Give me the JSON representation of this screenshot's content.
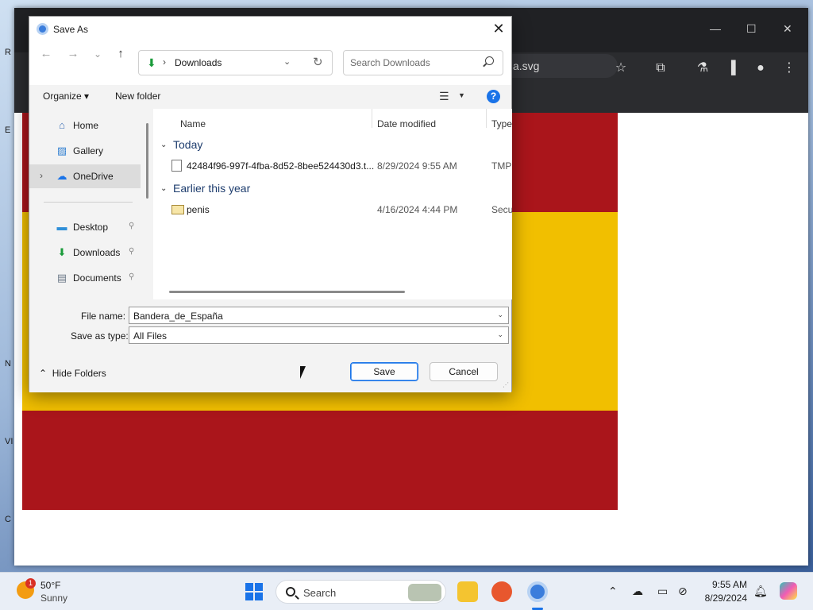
{
  "desktop": {
    "letters": [
      "R",
      "E",
      "N",
      "VI",
      "C"
    ]
  },
  "browser": {
    "omnibox_text": "a.svg",
    "window_controls": {
      "minimize": "—",
      "maximize": "☐",
      "close": "✕"
    }
  },
  "flag": {
    "colors": {
      "red": "#aa151b",
      "yellow": "#f1bf00"
    }
  },
  "dialog": {
    "title": "Save As",
    "close_glyph": "✕",
    "nav": {
      "back": "←",
      "forward": "→",
      "recent": "⌄",
      "up": "↑"
    },
    "address": {
      "separator": "›",
      "location": "Downloads"
    },
    "search": {
      "placeholder": "Search Downloads"
    },
    "commands": {
      "organize": "Organize ▾",
      "new_folder": "New folder",
      "help": "?"
    },
    "nav_pane": {
      "items": [
        {
          "label": "Home",
          "icon": "home-icon",
          "glyph": "⌂",
          "color": "#3b6fb6"
        },
        {
          "label": "Gallery",
          "icon": "gallery-icon",
          "glyph": "▨",
          "color": "#2f7fd1"
        },
        {
          "label": "OneDrive",
          "icon": "cloud-icon",
          "glyph": "☁",
          "color": "#1a73e8",
          "selected": true,
          "expand": "›"
        },
        {
          "label": "Desktop",
          "icon": "desktop-icon",
          "glyph": "▬",
          "color": "#2f8fd8",
          "pin": "⚲"
        },
        {
          "label": "Downloads",
          "icon": "download-icon",
          "glyph": "⬇",
          "color": "#1a9b3a",
          "pin": "⚲"
        },
        {
          "label": "Documents",
          "icon": "document-icon",
          "glyph": "▤",
          "color": "#6c7a89",
          "pin": "⚲"
        }
      ]
    },
    "columns": {
      "name": "Name",
      "date_modified": "Date modified",
      "type": "Type"
    },
    "groups": [
      {
        "label": "Today",
        "files": [
          {
            "name": "42484f96-997f-4fba-8d52-8bee524430d3.t...",
            "date": "8/29/2024 9:55 AM",
            "type": "TMP",
            "icon": "file-icon"
          }
        ]
      },
      {
        "label": "Earlier this year",
        "files": [
          {
            "name": "penis",
            "date": "4/16/2024 4:44 PM",
            "type": "Secu",
            "icon": "certificate-icon"
          }
        ]
      }
    ],
    "file_name": {
      "label": "File name:",
      "value": "Bandera_de_España"
    },
    "save_as_type": {
      "label": "Save as type:",
      "value": "All Files"
    },
    "hide_folders": "Hide Folders",
    "buttons": {
      "save": "Save",
      "cancel": "Cancel"
    },
    "accent": "#1a73e8"
  },
  "taskbar": {
    "weather": {
      "temp": "50°F",
      "condition": "Sunny",
      "badge": "1"
    },
    "search_label": "Search",
    "clock": {
      "time": "9:55 AM",
      "date": "8/29/2024"
    }
  }
}
